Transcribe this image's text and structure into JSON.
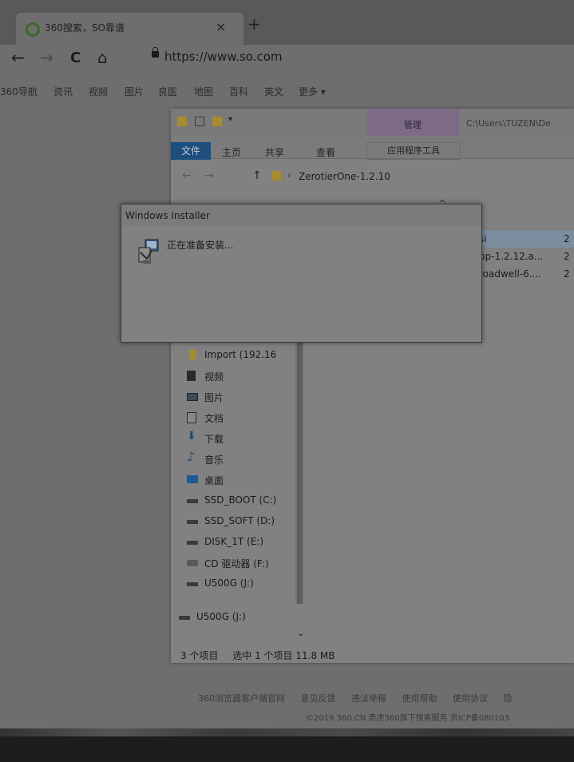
{
  "browser": {
    "tab": {
      "title": "360搜索，SO靠谱",
      "close": "×",
      "new_tab": "+"
    },
    "nav": {
      "back": "←",
      "forward": "→",
      "reload": "C",
      "home": "⌂"
    },
    "url": "https://www.so.com",
    "links": [
      "360导航",
      "资讯",
      "视频",
      "图片",
      "良医",
      "地图",
      "百科",
      "英文",
      "更多 ▾"
    ],
    "footer_links": [
      "360浏览器客户端官网",
      "意见反馈",
      "违法举报",
      "使用帮助",
      "使用协议",
      "隐"
    ],
    "footer_copyright": "©2019 360.CN 奇虎360旗下搜索服务 京ICP备080103"
  },
  "explorer": {
    "manage_label": "管理",
    "title_path": "C:\\Users\\TUZEN\\De",
    "ribbon": {
      "file": "文件",
      "home": "主页",
      "share": "共享",
      "view": "查看",
      "app_tools": "应用程序工具"
    },
    "address": {
      "back": "←",
      "forward": "→",
      "up": "↑",
      "folder": "ZerotierOne-1.2.10"
    },
    "column_header_arrow": "^",
    "files": [
      {
        "name": "si",
        "date": "2"
      },
      {
        "name": "pp-1.2.12.a...",
        "date": "2"
      },
      {
        "name": "roadwell-6....",
        "date": "2"
      }
    ],
    "nav_items": [
      {
        "label": "Import (192.16",
        "icon": "network-folder-icon"
      },
      {
        "label": "视频",
        "icon": "video-icon"
      },
      {
        "label": "图片",
        "icon": "picture-icon"
      },
      {
        "label": "文档",
        "icon": "document-icon"
      },
      {
        "label": "下载",
        "icon": "download-icon"
      },
      {
        "label": "音乐",
        "icon": "music-icon"
      },
      {
        "label": "桌面",
        "icon": "desktop-icon"
      },
      {
        "label": "SSD_BOOT (C:)",
        "icon": "system-drive-icon"
      },
      {
        "label": "SSD_SOFT (D:)",
        "icon": "drive-icon"
      },
      {
        "label": "DISK_1T (E:)",
        "icon": "drive-icon"
      },
      {
        "label": "CD 驱动器 (F:)",
        "icon": "cd-drive-icon"
      },
      {
        "label": "U500G (J:)",
        "icon": "drive-icon"
      }
    ],
    "nav_bottom_item": "U500G (J:)",
    "status": {
      "count": "3 个项目",
      "selected": "选中 1 个项目 11.8 MB"
    }
  },
  "installer": {
    "title": "Windows Installer",
    "message": "正在准备安装..."
  }
}
